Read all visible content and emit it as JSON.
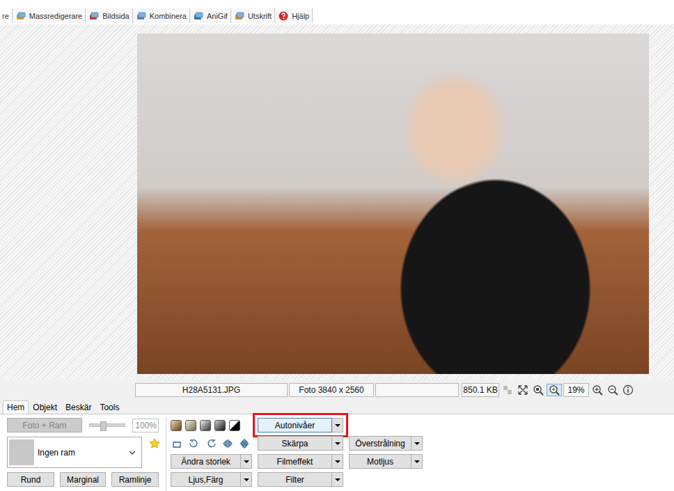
{
  "top_tabs": [
    {
      "label": "re",
      "selected": true,
      "icon": false,
      "color": "#000000"
    },
    {
      "label": "Massredigerare",
      "selected": false,
      "icon": true,
      "color": "#d9a21b"
    },
    {
      "label": "Bildsida",
      "selected": false,
      "icon": true,
      "color": "#c0392b"
    },
    {
      "label": "Kombinera",
      "selected": false,
      "icon": true,
      "color": "#6a7fc4"
    },
    {
      "label": "AniGif",
      "selected": false,
      "icon": true,
      "color": "#3b6fb6"
    },
    {
      "label": "Utskrift",
      "selected": false,
      "icon": true,
      "color": "#e08a1e"
    },
    {
      "label": "Hjälp",
      "selected": false,
      "icon": true,
      "color": "#d42a2a"
    }
  ],
  "status_bar": {
    "filename": "H28A5131.JPG",
    "dimensions": "Foto 3840 x 2560",
    "filesize": "850.1 KB",
    "zoom": "19%"
  },
  "panel_tabs": [
    {
      "label": "Hem",
      "selected": true
    },
    {
      "label": "Objekt",
      "selected": false
    },
    {
      "label": "Beskär",
      "selected": false
    },
    {
      "label": "Tools",
      "selected": false
    }
  ],
  "frame": {
    "button": "Foto + Ram",
    "disabled": true,
    "slider_level": 0.35,
    "opacity": "100%",
    "frame_name": "Ingen ram",
    "buttons": [
      "Rund",
      "Marginal",
      "Ramlinje"
    ]
  },
  "tools": {
    "left": [
      {
        "label": "Ändra storlek",
        "highlighted": false
      },
      {
        "label": "Ljus,Färg",
        "highlighted": false
      }
    ],
    "middle": [
      {
        "label": "Autonivåer",
        "highlighted": true
      },
      {
        "label": "Skärpa",
        "highlighted": false
      },
      {
        "label": "Filmeffekt",
        "highlighted": false
      },
      {
        "label": "Filter",
        "highlighted": false
      }
    ],
    "right": [
      {
        "label": "Överstrålning",
        "highlighted": false
      },
      {
        "label": "Motljus",
        "highlighted": false
      }
    ]
  }
}
